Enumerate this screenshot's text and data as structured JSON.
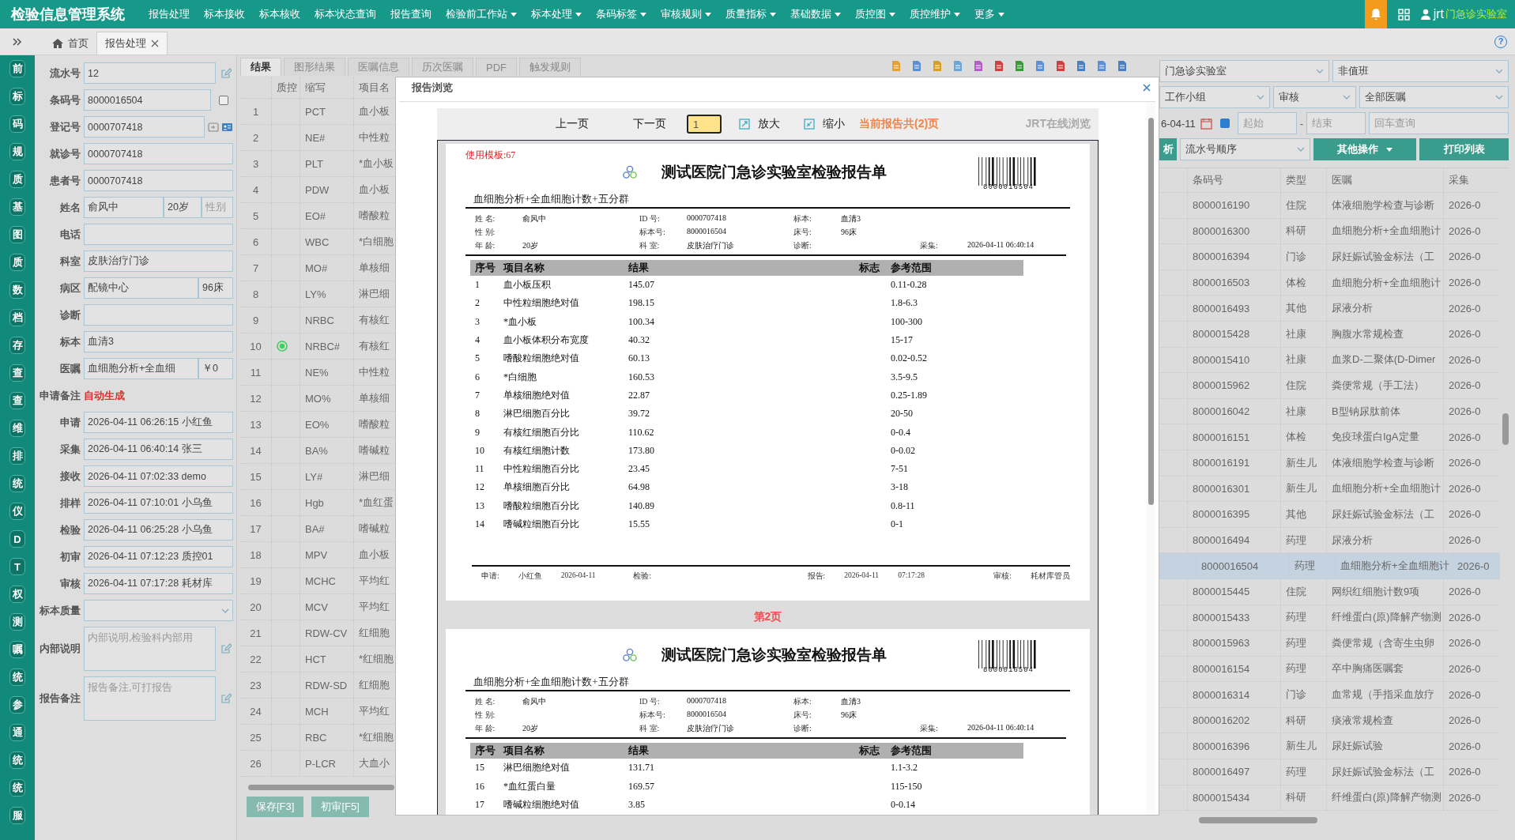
{
  "topbar": {
    "title": "检验信息管理系统",
    "menu": [
      {
        "label": "报告处理",
        "dropdown": false
      },
      {
        "label": "标本接收",
        "dropdown": false
      },
      {
        "label": "标本核收",
        "dropdown": false
      },
      {
        "label": "标本状态查询",
        "dropdown": false
      },
      {
        "label": "报告查询",
        "dropdown": false
      },
      {
        "label": "检验前工作站",
        "dropdown": true
      },
      {
        "label": "标本处理",
        "dropdown": true
      },
      {
        "label": "条码标签",
        "dropdown": true
      },
      {
        "label": "审核规则",
        "dropdown": true
      },
      {
        "label": "质量指标",
        "dropdown": true
      },
      {
        "label": "基础数据",
        "dropdown": true
      },
      {
        "label": "质控图",
        "dropdown": true
      },
      {
        "label": "质控维护",
        "dropdown": true
      },
      {
        "label": "更多",
        "dropdown": true
      }
    ],
    "user": "jrt",
    "lab": "门急诊实验室"
  },
  "tabs": [
    {
      "label": "首页",
      "selected": false,
      "kind": "home"
    },
    {
      "label": "报告处理",
      "selected": true,
      "kind": "closable"
    }
  ],
  "help": "?",
  "sidebar": [
    "前",
    "标",
    "码",
    "规",
    "质",
    "基",
    "图",
    "质",
    "数",
    "档",
    "存",
    "查",
    "查",
    "维",
    "排",
    "统",
    "仪",
    "D",
    "T",
    "权",
    "测",
    "嘱",
    "统",
    "参",
    "通",
    "统",
    "统",
    "服"
  ],
  "form": {
    "fields": [
      {
        "label": "流水号",
        "kind": "text-edit",
        "parts": [
          {
            "value": "12"
          }
        ]
      },
      {
        "label": "条码号",
        "kind": "text-check",
        "checked": false,
        "parts": [
          {
            "value": "8000016504"
          }
        ]
      },
      {
        "label": "登记号",
        "kind": "text-lookup",
        "parts": [
          {
            "value": "0000707418"
          }
        ]
      },
      {
        "label": "就诊号",
        "kind": "text",
        "parts": [
          {
            "value": "0000707418"
          }
        ]
      },
      {
        "label": "患者号",
        "kind": "text",
        "parts": [
          {
            "value": "0000707418"
          }
        ]
      },
      {
        "label": "姓名",
        "kind": "text",
        "parts": [
          {
            "value": "俞风中"
          },
          {
            "value": "20岁"
          },
          {
            "placeholder": "性别"
          }
        ]
      },
      {
        "label": "电话",
        "kind": "text"
      },
      {
        "label": "科室",
        "kind": "text",
        "parts": [
          {
            "value": "皮肤治疗门诊"
          }
        ]
      },
      {
        "label": "病区",
        "kind": "text",
        "parts": [
          {
            "value": "配镜中心"
          },
          {
            "value": "96床"
          }
        ]
      },
      {
        "label": "诊断",
        "kind": "text"
      },
      {
        "label": "标本",
        "kind": "text",
        "parts": [
          {
            "value": "血清3"
          }
        ]
      },
      {
        "label": "医嘱",
        "kind": "text",
        "parts": [
          {
            "value": "血细胞分析+全血细"
          },
          {
            "value": "￥0"
          }
        ]
      },
      {
        "label": "申请备注",
        "kind": "note",
        "value": "自动生成"
      },
      {
        "label": "申请",
        "kind": "text",
        "parts": [
          {
            "value": "2026-04-11 06:26:15 小红鱼"
          }
        ]
      },
      {
        "label": "采集",
        "kind": "text",
        "parts": [
          {
            "value": "2026-04-11 06:40:14 张三"
          }
        ]
      },
      {
        "label": "接收",
        "kind": "text",
        "parts": [
          {
            "value": "2026-04-11 07:02:33 demo"
          }
        ]
      },
      {
        "label": "排样",
        "kind": "text",
        "parts": [
          {
            "value": "2026-04-11 07:10:01 小乌鱼"
          }
        ]
      },
      {
        "label": "检验",
        "kind": "text",
        "parts": [
          {
            "value": "2026-04-11 06:25:28 小乌鱼"
          }
        ]
      },
      {
        "label": "初审",
        "kind": "text",
        "parts": [
          {
            "value": "2026-04-11 07:12:23 质控01"
          }
        ]
      },
      {
        "label": "审核",
        "kind": "text",
        "parts": [
          {
            "value": "2026-04-11 07:17:28 耗材库"
          }
        ]
      },
      {
        "label": "标本质量",
        "kind": "select"
      },
      {
        "label": "内部说明",
        "kind": "textarea",
        "placeholder": "内部说明,检验科内部用"
      },
      {
        "label": "报告备注",
        "kind": "textarea",
        "placeholder": "报告备注,可打报告"
      }
    ]
  },
  "middle": {
    "tabs": [
      {
        "label": "结果",
        "selected": true
      },
      {
        "label": "图形结果",
        "selected": false
      },
      {
        "label": "医嘱信息",
        "selected": false
      },
      {
        "label": "历次医嘱",
        "selected": false
      },
      {
        "label": "PDF",
        "selected": false
      },
      {
        "label": "触发规则",
        "selected": false
      }
    ],
    "columns": [
      "质控",
      "缩写",
      "项目名"
    ],
    "rows": [
      {
        "no": "1",
        "qc": false,
        "code": "PCT",
        "name": "血小板"
      },
      {
        "no": "2",
        "qc": false,
        "code": "NE#",
        "name": "中性粒"
      },
      {
        "no": "3",
        "qc": false,
        "code": "PLT",
        "name": "*血小板"
      },
      {
        "no": "4",
        "qc": false,
        "code": "PDW",
        "name": "血小板"
      },
      {
        "no": "5",
        "qc": false,
        "code": "EO#",
        "name": "嗜酸粒"
      },
      {
        "no": "6",
        "qc": false,
        "code": "WBC",
        "name": "*白细胞"
      },
      {
        "no": "7",
        "qc": false,
        "code": "MO#",
        "name": "单核细"
      },
      {
        "no": "8",
        "qc": false,
        "code": "LY%",
        "name": "淋巴细"
      },
      {
        "no": "9",
        "qc": false,
        "code": "NRBC",
        "name": "有核红"
      },
      {
        "no": "10",
        "qc": true,
        "code": "NRBC#",
        "name": "有核红"
      },
      {
        "no": "11",
        "qc": false,
        "code": "NE%",
        "name": "中性粒"
      },
      {
        "no": "12",
        "qc": false,
        "code": "MO%",
        "name": "单核细"
      },
      {
        "no": "13",
        "qc": false,
        "code": "EO%",
        "name": "嗜酸粒"
      },
      {
        "no": "14",
        "qc": false,
        "code": "BA%",
        "name": "嗜碱粒"
      },
      {
        "no": "15",
        "qc": false,
        "code": "LY#",
        "name": "淋巴细"
      },
      {
        "no": "16",
        "qc": false,
        "code": "Hgb",
        "name": "*血红蛋"
      },
      {
        "no": "17",
        "qc": false,
        "code": "BA#",
        "name": "嗜碱粒"
      },
      {
        "no": "18",
        "qc": false,
        "code": "MPV",
        "name": "血小板"
      },
      {
        "no": "19",
        "qc": false,
        "code": "MCHC",
        "name": "平均红"
      },
      {
        "no": "20",
        "qc": false,
        "code": "MCV",
        "name": "平均红"
      },
      {
        "no": "21",
        "qc": false,
        "code": "RDW-CV",
        "name": "红细胞"
      },
      {
        "no": "22",
        "qc": false,
        "code": "HCT",
        "name": "*红细胞"
      },
      {
        "no": "23",
        "qc": false,
        "code": "RDW-SD",
        "name": "红细胞"
      },
      {
        "no": "24",
        "qc": false,
        "code": "MCH",
        "name": "平均红"
      },
      {
        "no": "25",
        "qc": false,
        "code": "RBC",
        "name": "*红细胞"
      },
      {
        "no": "26",
        "qc": false,
        "code": "P-LCR",
        "name": "大血小"
      }
    ],
    "buttons": [
      "保存[F3]",
      "初审[F5]"
    ]
  },
  "modal": {
    "title": "报告浏览",
    "toolbar": {
      "prev": "上一页",
      "next": "下一页",
      "page": "1",
      "zoom_in": "放大",
      "zoom_out": "缩小",
      "total": "当前报告共(2)页",
      "brand": "JRT在线浏览"
    },
    "pages": [
      {
        "template": "使用模板:67",
        "title": "测试医院门急诊实验室检验报告单",
        "subtitle": "血细胞分析+全血细胞计数+五分群",
        "barcode": "8000016504",
        "info": [
          [
            {
              "label": "姓 名:",
              "value": "俞风中"
            },
            {
              "label": "ID  号:",
              "value": "0000707418"
            },
            {
              "label": "标本:",
              "value": "血清3"
            }
          ],
          [
            {
              "label": "性 别:"
            },
            {
              "label": "标本号:",
              "value": "8000016504"
            },
            {
              "label": "床号:",
              "value": "96床"
            }
          ],
          [
            {
              "label": "年 龄:",
              "value": "20岁"
            },
            {
              "label": "科  室:",
              "value": "皮肤治疗门诊"
            },
            {
              "label": "诊断:"
            },
            {
              "label": "采集:",
              "value": "2026-04-11   06:40:14"
            }
          ]
        ],
        "columns": [
          "序号",
          "项目名称",
          "结果",
          "标志",
          "参考范围"
        ],
        "rows": [
          [
            "1",
            "血小板压积",
            "145.07",
            "",
            "0.11-0.28"
          ],
          [
            "2",
            "中性粒细胞绝对值",
            "198.15",
            "",
            "1.8-6.3"
          ],
          [
            "3",
            "*血小板",
            "100.34",
            "",
            "100-300"
          ],
          [
            "4",
            "血小板体积分布宽度",
            "40.32",
            "",
            "15-17"
          ],
          [
            "5",
            "嗜酸粒细胞绝对值",
            "60.13",
            "",
            "0.02-0.52"
          ],
          [
            "6",
            "*白细胞",
            "160.53",
            "",
            "3.5-9.5"
          ],
          [
            "7",
            "单核细胞绝对值",
            "22.87",
            "",
            "0.25-1.89"
          ],
          [
            "8",
            "淋巴细胞百分比",
            "39.72",
            "",
            "20-50"
          ],
          [
            "9",
            "有核红细胞百分比",
            "110.62",
            "",
            "0-0.4"
          ],
          [
            "10",
            "有核红细胞计数",
            "173.80",
            "",
            "0-0.02"
          ],
          [
            "11",
            "中性粒细胞百分比",
            "23.45",
            "",
            "7-51"
          ],
          [
            "12",
            "单核细胞百分比",
            "64.98",
            "",
            "3-18"
          ],
          [
            "13",
            "嗜酸粒细胞百分比",
            "140.89",
            "",
            "0.8-11"
          ],
          [
            "14",
            "嗜碱粒细胞百分比",
            "15.55",
            "",
            "0-1"
          ]
        ],
        "footer": [
          {
            "label": "申请:",
            "values": [
              "小红鱼",
              "2026-04-11"
            ]
          },
          {
            "label": "检验:"
          },
          {
            "label": "报告:",
            "values": [
              "2026-04-11",
              "07:17:28"
            ]
          },
          {
            "label": "审核:",
            "values": [
              "耗材库管员"
            ]
          }
        ]
      },
      {
        "page_label": "第2页",
        "title": "测试医院门急诊实验室检验报告单",
        "subtitle": "血细胞分析+全血细胞计数+五分群",
        "barcode": "8000016504",
        "info": [
          [
            {
              "label": "姓 名:",
              "value": "俞风中"
            },
            {
              "label": "ID  号:",
              "value": "0000707418"
            },
            {
              "label": "标本:",
              "value": "血清3"
            }
          ],
          [
            {
              "label": "性 别:"
            },
            {
              "label": "标本号:",
              "value": "8000016504"
            },
            {
              "label": "床号:",
              "value": "96床"
            }
          ],
          [
            {
              "label": "年 龄:",
              "value": "20岁"
            },
            {
              "label": "科  室:",
              "value": "皮肤治疗门诊"
            },
            {
              "label": "诊断:"
            },
            {
              "label": "采集:",
              "value": "2026-04-11   06:40:14"
            }
          ]
        ],
        "columns": [
          "序号",
          "项目名称",
          "结果",
          "标志",
          "参考范围"
        ],
        "rows": [
          [
            "15",
            "淋巴细胞绝对值",
            "131.71",
            "",
            "1.1-3.2"
          ],
          [
            "16",
            "*血红蛋白量",
            "169.57",
            "",
            "115-150"
          ],
          [
            "17",
            "嗜碱粒细胞绝对值",
            "3.85",
            "",
            "0-0.14"
          ]
        ]
      }
    ]
  },
  "right": {
    "lab": "门急诊实验室",
    "duty": "非值班",
    "group": "工作小组",
    "status": "审核",
    "orders": "全部医嘱",
    "date": "6-04-11",
    "range_checked": true,
    "start_placeholder": "起始",
    "range_separator": "-",
    "end_placeholder": "结束",
    "query_placeholder": "回车查询",
    "cut_button": "析",
    "sort": "流水号顺序",
    "more": "其他操作",
    "print": "打印列表",
    "columns": [
      "条码号",
      "类型",
      "医嘱",
      "采集"
    ],
    "rows": [
      {
        "barcode": "8000016190",
        "type": "住院",
        "order": "体液细胞学检查与诊断",
        "collected": "2026-0",
        "selected": false
      },
      {
        "barcode": "8000016300",
        "type": "科研",
        "order": "血细胞分析+全血细胞计",
        "collected": "2026-0",
        "selected": false
      },
      {
        "barcode": "8000016394",
        "type": "门诊",
        "order": "尿妊娠试验金标法（工",
        "collected": "2026-0",
        "selected": false
      },
      {
        "barcode": "8000016503",
        "type": "体检",
        "order": "血细胞分析+全血细胞计",
        "collected": "2026-0",
        "selected": false
      },
      {
        "barcode": "8000016493",
        "type": "其他",
        "order": "尿液分析",
        "collected": "2026-0",
        "selected": false
      },
      {
        "barcode": "8000015428",
        "type": "社康",
        "order": "胸腹水常规检查",
        "collected": "2026-0",
        "selected": false
      },
      {
        "barcode": "8000015410",
        "type": "社康",
        "order": "血浆D-二聚体(D-Dimer",
        "collected": "2026-0",
        "selected": false
      },
      {
        "barcode": "8000015962",
        "type": "住院",
        "order": "粪便常规（手工法）",
        "collected": "2026-0",
        "selected": false
      },
      {
        "barcode": "8000016042",
        "type": "社康",
        "order": "B型钠尿肽前体",
        "collected": "2026-0",
        "selected": false
      },
      {
        "barcode": "8000016151",
        "type": "体检",
        "order": "免疫球蛋白IgA定量",
        "collected": "2026-0",
        "selected": false
      },
      {
        "barcode": "8000016191",
        "type": "新生儿",
        "order": "体液细胞学检查与诊断",
        "collected": "2026-0",
        "selected": false
      },
      {
        "barcode": "8000016301",
        "type": "新生儿",
        "order": "血细胞分析+全血细胞计",
        "collected": "2026-0",
        "selected": false
      },
      {
        "barcode": "8000016395",
        "type": "其他",
        "order": "尿妊娠试验金标法（工",
        "collected": "2026-0",
        "selected": false
      },
      {
        "barcode": "8000016494",
        "type": "药理",
        "order": "尿液分析",
        "collected": "2026-0",
        "selected": false
      },
      {
        "barcode": "8000016504",
        "type": "药理",
        "order": "血细胞分析+全血细胞计",
        "collected": "2026-0",
        "selected": true
      },
      {
        "barcode": "8000015445",
        "type": "住院",
        "order": "网织红细胞计数9项",
        "collected": "2026-0",
        "selected": false
      },
      {
        "barcode": "8000015433",
        "type": "药理",
        "order": "纤维蛋白(原)降解产物测",
        "collected": "2026-0",
        "selected": false
      },
      {
        "barcode": "8000015963",
        "type": "药理",
        "order": "粪便常规（含寄生虫卵",
        "collected": "2026-0",
        "selected": false
      },
      {
        "barcode": "8000016154",
        "type": "药理",
        "order": "卒中胸痛医嘱套",
        "collected": "2026-0",
        "selected": false
      },
      {
        "barcode": "8000016314",
        "type": "门诊",
        "order": "血常规（手指采血放疗",
        "collected": "2026-0",
        "selected": false
      },
      {
        "barcode": "8000016202",
        "type": "科研",
        "order": "痰液常规检查",
        "collected": "2026-0",
        "selected": false
      },
      {
        "barcode": "8000016396",
        "type": "新生儿",
        "order": "尿妊娠试验",
        "collected": "2026-0",
        "selected": false
      },
      {
        "barcode": "8000016497",
        "type": "药理",
        "order": "尿妊娠试验金标法（工",
        "collected": "2026-0",
        "selected": false
      },
      {
        "barcode": "8000015434",
        "type": "科研",
        "order": "纤维蛋白(原)降解产物测",
        "collected": "2026-0",
        "selected": false
      }
    ]
  }
}
